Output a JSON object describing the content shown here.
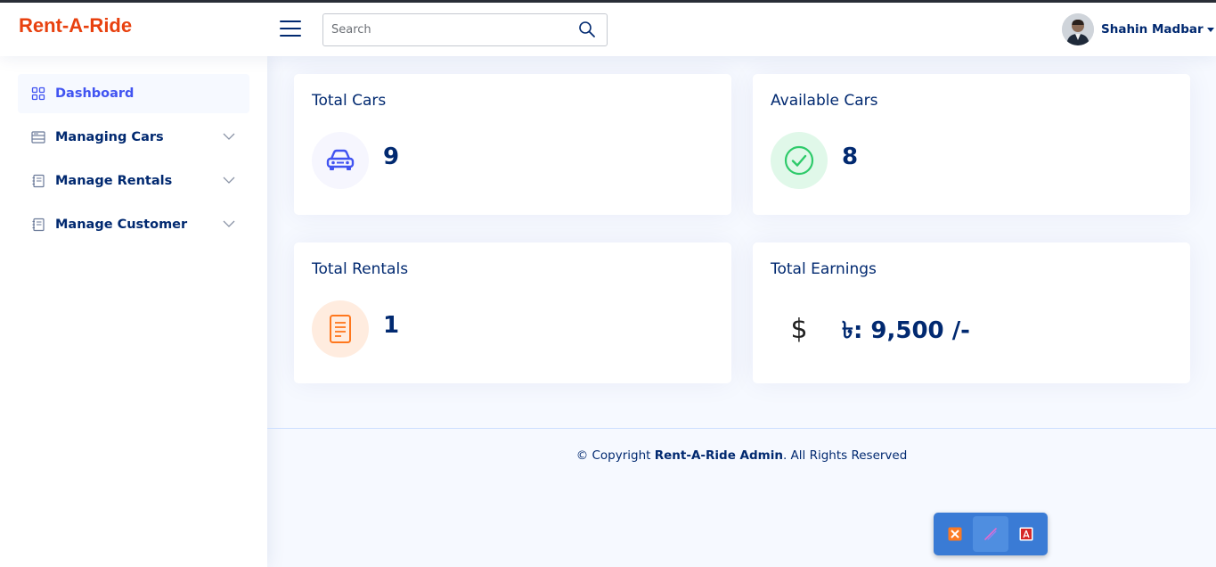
{
  "app": {
    "logo": "Rent-A-Ride"
  },
  "search": {
    "placeholder": "Search"
  },
  "user": {
    "name": "Shahin Madbar"
  },
  "sidebar": {
    "items": [
      {
        "label": "Dashboard",
        "icon": "grid-icon",
        "active": true
      },
      {
        "label": "Managing Cars",
        "icon": "menu-list-icon"
      },
      {
        "label": "Manage Rentals",
        "icon": "journal-icon"
      },
      {
        "label": "Manage Customer",
        "icon": "journal-icon"
      }
    ]
  },
  "cards": {
    "total_cars": {
      "title": "Total Cars",
      "value": "9",
      "icon": "car-icon"
    },
    "available_cars": {
      "title": "Available Cars",
      "value": "8",
      "icon": "check-circle-icon"
    },
    "total_rentals": {
      "title": "Total Rentals",
      "value": "1",
      "icon": "document-icon"
    },
    "total_earnings": {
      "title": "Total Earnings",
      "value": "৳: 9,500 /-",
      "icon_text": "$"
    }
  },
  "footer": {
    "prefix": "© Copyright ",
    "brand": "Rent-A-Ride Admin",
    "suffix": ". All Rights Reserved"
  },
  "colors": {
    "accent": "#4154f1",
    "logo": "#e8410f",
    "navy": "#012970",
    "success": "#2eca6a",
    "warning": "#ff771d"
  }
}
